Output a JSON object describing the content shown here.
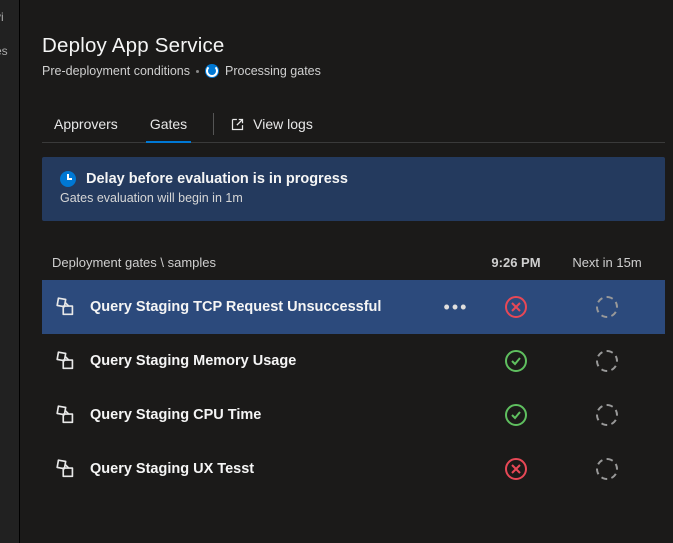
{
  "header": {
    "title": "Deploy App Service",
    "breadcrumb_pre": "Pre-deployment conditions",
    "status_label": "Processing gates"
  },
  "tabs": {
    "approvers": "Approvers",
    "gates": "Gates",
    "viewlogs": "View logs"
  },
  "banner": {
    "title": "Delay before evaluation is in progress",
    "subtitle": "Gates evaluation will begin in 1m"
  },
  "list": {
    "header_name": "Deployment gates \\ samples",
    "header_time": "9:26 PM",
    "header_next": "Next in 15m"
  },
  "gates": [
    {
      "label": "Query Staging TCP Request Unsuccessful",
      "status": "fail",
      "selected": true,
      "menu": true
    },
    {
      "label": "Query Staging Memory Usage",
      "status": "pass",
      "selected": false,
      "menu": false
    },
    {
      "label": "Query Staging CPU Time",
      "status": "pass",
      "selected": false,
      "menu": false
    },
    {
      "label": "Query Staging UX Tesst",
      "status": "fail",
      "selected": false,
      "menu": false
    }
  ]
}
